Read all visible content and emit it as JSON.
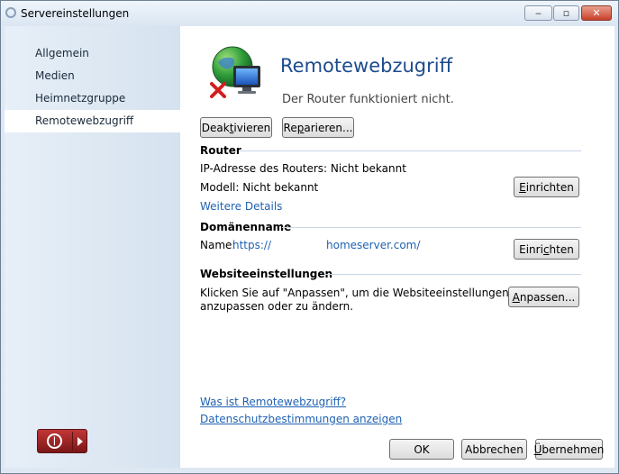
{
  "window": {
    "title": "Servereinstellungen",
    "controls": {
      "minimize": "‒",
      "maximize": "▫",
      "close": "✕"
    }
  },
  "sidebar": {
    "items": [
      {
        "label": "Allgemein",
        "active": false
      },
      {
        "label": "Medien",
        "active": false
      },
      {
        "label": "Heimnetzgruppe",
        "active": false
      },
      {
        "label": "Remotewebzugriff",
        "active": true
      }
    ]
  },
  "header": {
    "title": "Remotewebzugriff",
    "status": "Der Router funktioniert nicht.",
    "icon": "globe-error-icon"
  },
  "actions": {
    "deactivate": {
      "pre": "Deak",
      "key": "t",
      "post": "ivieren"
    },
    "repair": {
      "pre": "Re",
      "key": "p",
      "post": "arieren..."
    }
  },
  "router": {
    "heading": "Router",
    "ip_line": "IP-Adresse des Routers: Nicht bekannt",
    "model_line": "Modell: Nicht bekannt",
    "details_link": "Weitere Details",
    "setup_button": {
      "key": "E",
      "post": "inrichten"
    }
  },
  "domain": {
    "heading": "Domänenname",
    "name_label": "Name:",
    "url_prefix": "https://",
    "url_suffix": "homeserver.com/",
    "setup_button": {
      "pre": "Einri",
      "key": "c",
      "post": "hten"
    }
  },
  "website": {
    "heading": "Websiteeinstellungen",
    "desc_line1": "Klicken Sie auf \"Anpassen\", um die Websiteeinstellungen",
    "desc_line2": "anzupassen oder zu ändern.",
    "customize_button": {
      "key": "A",
      "post": "npassen..."
    }
  },
  "footer_links": {
    "what_is": "Was ist Remotewebzugriff?",
    "privacy": "Datenschutzbestimmungen anzeigen"
  },
  "dialog_buttons": {
    "ok": "OK",
    "cancel": "Abbrechen",
    "apply": {
      "key": "Ü",
      "post": "bernehmen"
    }
  },
  "colors": {
    "title_blue": "#1d4c8d",
    "link_blue": "#1f62b3",
    "power_red": "#a82424",
    "sidebar_bg": "#dde8f3"
  }
}
